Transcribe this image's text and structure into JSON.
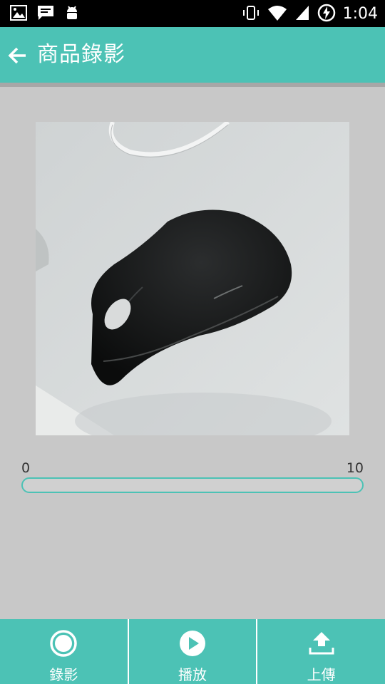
{
  "status_bar": {
    "time": "1:04",
    "icons": [
      "image-notification-icon",
      "message-notification-icon",
      "android-debug-icon",
      "vibrate-icon",
      "wifi-icon",
      "signal-icon",
      "battery-charging-icon"
    ]
  },
  "app_bar": {
    "title": "商品錄影",
    "back_icon": "arrow-back-icon"
  },
  "preview": {
    "subject_icon": "computer-mouse-photo"
  },
  "recording_progress": {
    "min_label": "0",
    "max_label": "10",
    "value": 0
  },
  "bottom_nav": {
    "items": [
      {
        "label": "錄影",
        "icon": "record-icon"
      },
      {
        "label": "播放",
        "icon": "play-icon"
      },
      {
        "label": "上傳",
        "icon": "upload-icon"
      }
    ]
  },
  "colors": {
    "primary": "#4cc2b5",
    "background": "#c8c8c8",
    "status_bar": "#000000"
  }
}
